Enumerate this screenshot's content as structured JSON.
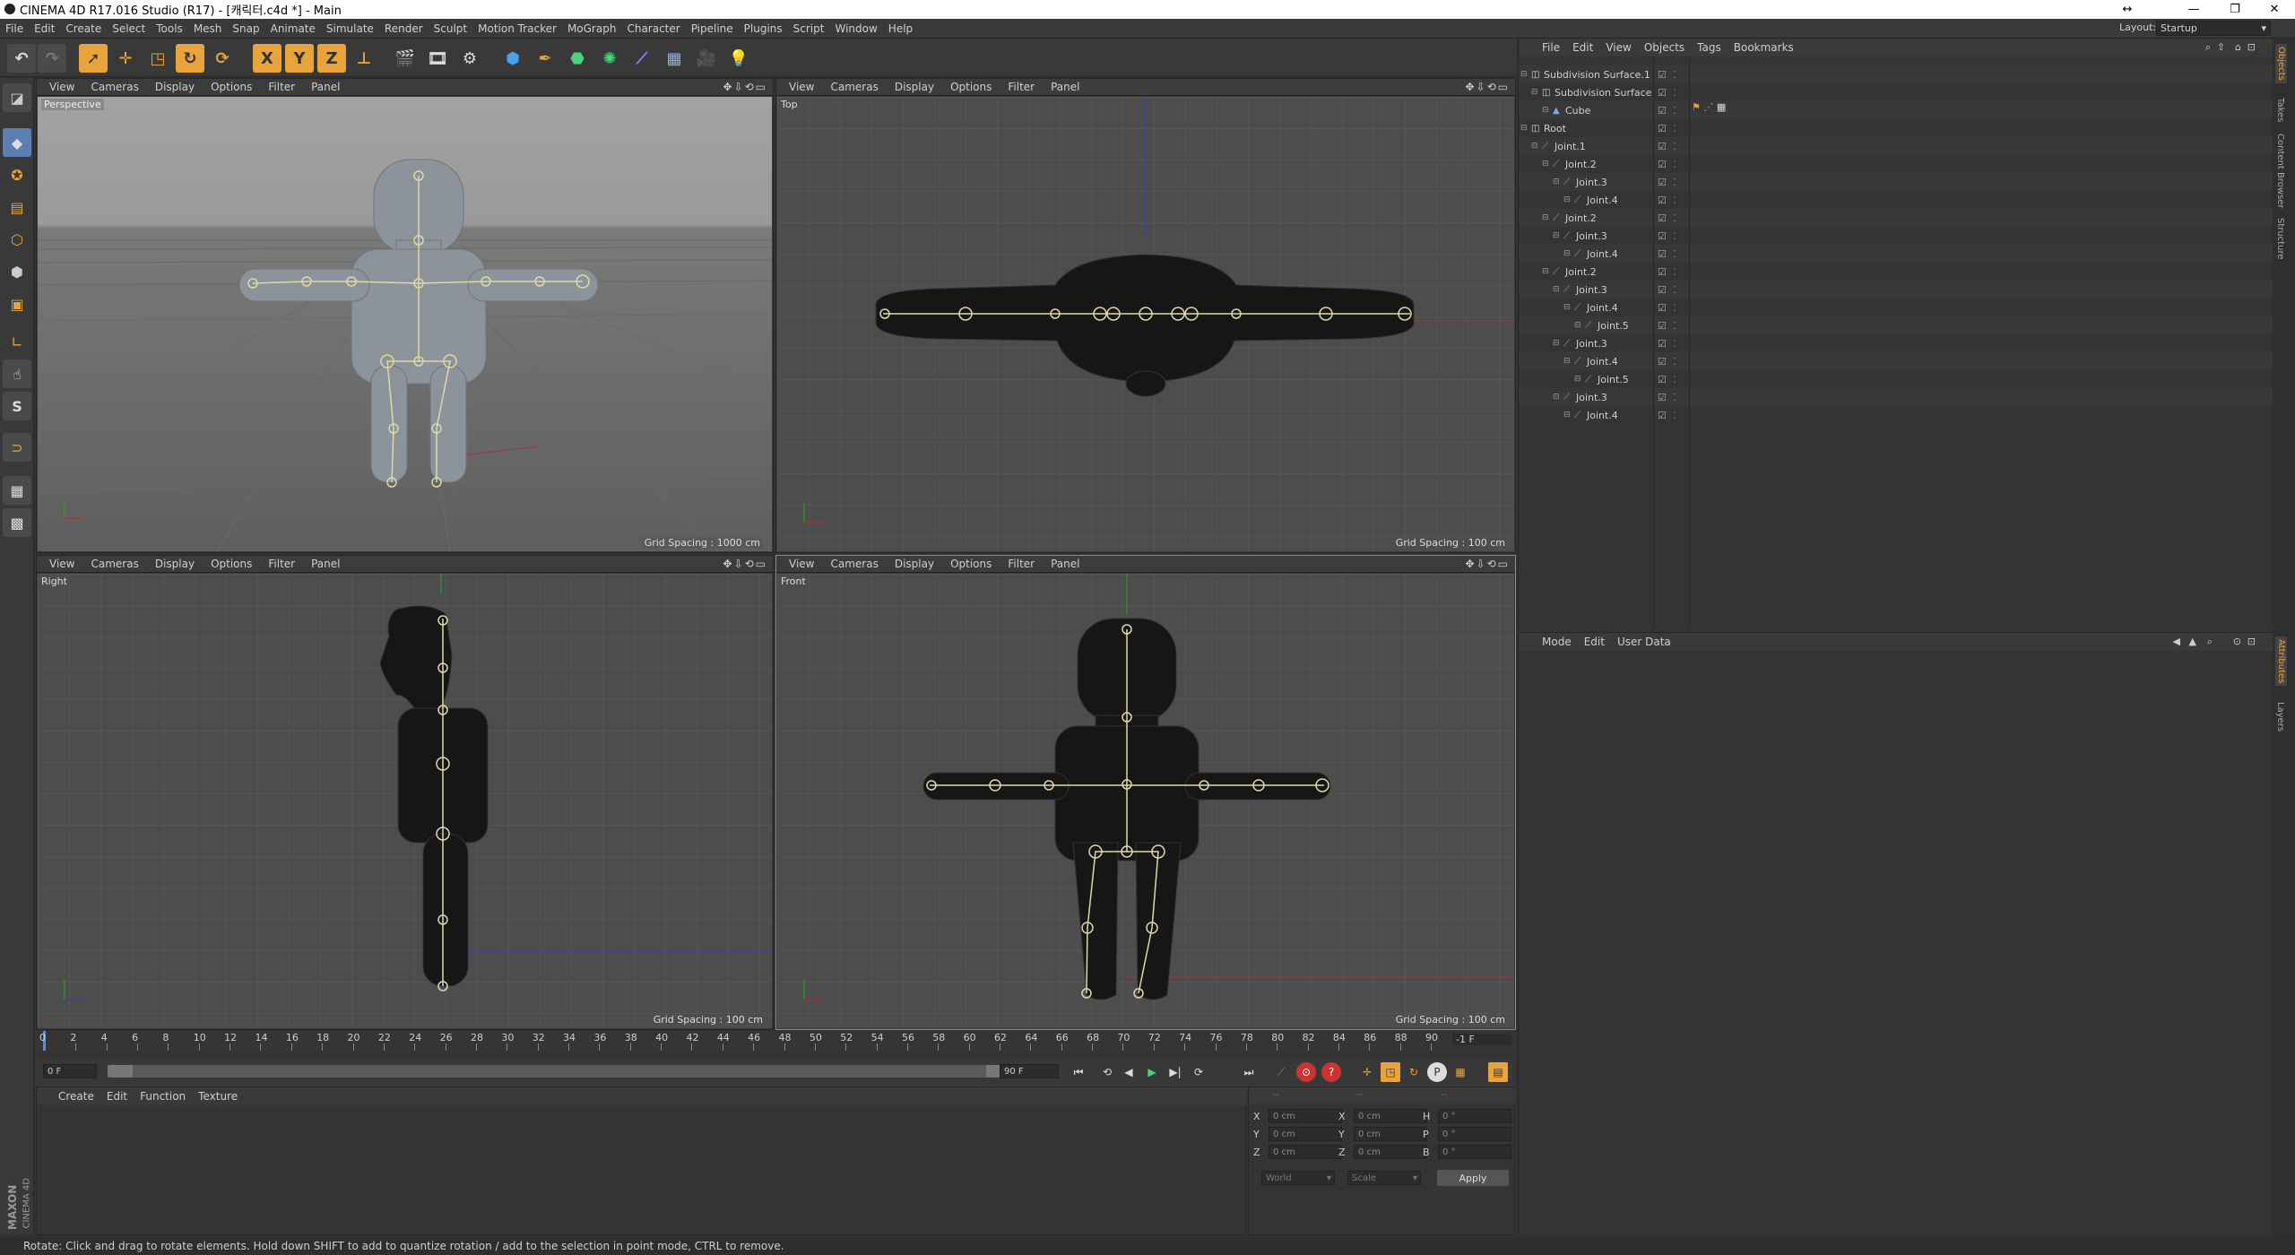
{
  "window": {
    "title": "CINEMA 4D R17.016 Studio (R17) - [캐릭터.c4d *] - Main"
  },
  "menu": [
    "File",
    "Edit",
    "Create",
    "Select",
    "Tools",
    "Mesh",
    "Snap",
    "Animate",
    "Simulate",
    "Render",
    "Sculpt",
    "Motion Tracker",
    "MoGraph",
    "Character",
    "Pipeline",
    "Plugins",
    "Script",
    "Window",
    "Help"
  ],
  "layout": {
    "label": "Layout:",
    "value": "Startup"
  },
  "viewport_menu": [
    "View",
    "Cameras",
    "Display",
    "Options",
    "Filter",
    "Panel"
  ],
  "viewports": [
    {
      "name": "Perspective",
      "grid": "Grid Spacing : 1000 cm"
    },
    {
      "name": "Top",
      "grid": "Grid Spacing : 100 cm"
    },
    {
      "name": "Right",
      "grid": "Grid Spacing : 100 cm"
    },
    {
      "name": "Front",
      "grid": "Grid Spacing : 100 cm"
    }
  ],
  "timeline": {
    "ticks": [
      "0",
      "2",
      "4",
      "6",
      "8",
      "10",
      "12",
      "14",
      "16",
      "18",
      "20",
      "22",
      "24",
      "26",
      "28",
      "30",
      "32",
      "34",
      "36",
      "38",
      "40",
      "42",
      "44",
      "46",
      "48",
      "50",
      "52",
      "54",
      "56",
      "58",
      "60",
      "62",
      "64",
      "66",
      "68",
      "70",
      "72",
      "74",
      "76",
      "78",
      "80",
      "82",
      "84",
      "86",
      "88",
      "90"
    ],
    "current": "0 F",
    "end_readout": "-1 F",
    "start_field": "0 F",
    "end_field": "90 F"
  },
  "object_manager": {
    "menu": [
      "File",
      "Edit",
      "View",
      "Objects",
      "Tags",
      "Bookmarks"
    ],
    "objects": [
      {
        "name": "Subdivision Surface.1",
        "depth": 0
      },
      {
        "name": "Subdivision Surface",
        "depth": 1
      },
      {
        "name": "Cube",
        "depth": 2
      },
      {
        "name": "Root",
        "depth": 0
      },
      {
        "name": "Joint.1",
        "depth": 1
      },
      {
        "name": "Joint.2",
        "depth": 2
      },
      {
        "name": "Joint.3",
        "depth": 3
      },
      {
        "name": "Joint.4",
        "depth": 4
      },
      {
        "name": "Joint.2",
        "depth": 2
      },
      {
        "name": "Joint.3",
        "depth": 3
      },
      {
        "name": "Joint.4",
        "depth": 4
      },
      {
        "name": "Joint.2",
        "depth": 2
      },
      {
        "name": "Joint.3",
        "depth": 3
      },
      {
        "name": "Joint.4",
        "depth": 4
      },
      {
        "name": "Joint.5",
        "depth": 5
      },
      {
        "name": "Joint.3",
        "depth": 3
      },
      {
        "name": "Joint.4",
        "depth": 4
      },
      {
        "name": "Joint.5",
        "depth": 5
      },
      {
        "name": "Joint.3",
        "depth": 3
      },
      {
        "name": "Joint.4",
        "depth": 4
      }
    ]
  },
  "attributes": {
    "menu": [
      "Mode",
      "Edit",
      "User Data"
    ]
  },
  "side_tabs": [
    "Objects",
    "Takes",
    "Content Browser",
    "Structure"
  ],
  "side_tabs_lower": [
    "Attributes",
    "Layers"
  ],
  "material_menu": [
    "Create",
    "Edit",
    "Function",
    "Texture"
  ],
  "coords": {
    "rows": [
      {
        "a": "X",
        "a_val": "0 cm",
        "b": "X",
        "b_val": "0 cm",
        "c": "H",
        "c_val": "0 °"
      },
      {
        "a": "Y",
        "a_val": "0 cm",
        "b": "Y",
        "b_val": "0 cm",
        "c": "P",
        "c_val": "0 °"
      },
      {
        "a": "Z",
        "a_val": "0 cm",
        "b": "Z",
        "b_val": "0 cm",
        "c": "B",
        "c_val": "0 °"
      }
    ],
    "header_a": "--",
    "header_b": "--",
    "header_c": "--",
    "world": "World",
    "scale": "Scale",
    "apply": "Apply"
  },
  "status": "Rotate: Click and drag to rotate elements. Hold down SHIFT to add to quantize rotation / add to the selection in point mode, CTRL to remove.",
  "brand": [
    "MAXON",
    "CINEMA 4D"
  ],
  "colors": {
    "accent": "#e8a33b",
    "bg": "#333333",
    "x_axis": "#cc2222",
    "y_axis": "#22aa22",
    "z_axis": "#2244cc"
  }
}
